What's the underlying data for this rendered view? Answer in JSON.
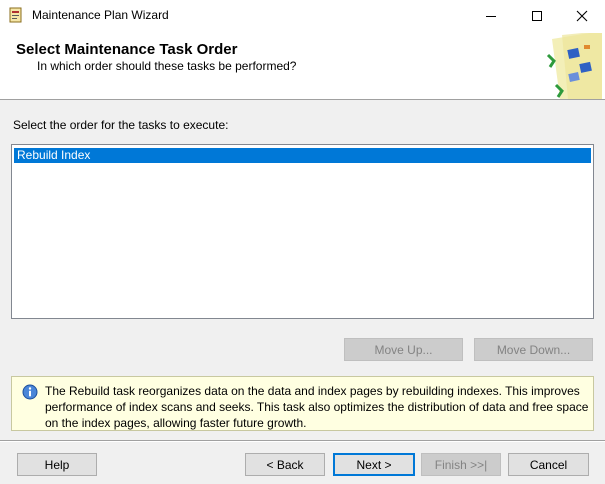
{
  "window": {
    "title": "Maintenance Plan Wizard",
    "icons": {
      "app": "wizard-app-icon",
      "minimize": "minimize-icon",
      "maximize": "maximize-icon",
      "close": "close-icon"
    }
  },
  "header": {
    "title": "Select Maintenance Task Order",
    "subtitle": "In which order should these tasks be performed?",
    "art": "wizard-graphic-icon"
  },
  "main": {
    "instruction": "Select the order for the tasks to execute:",
    "tasks": [
      {
        "label": "Rebuild Index",
        "selected": true
      }
    ],
    "move_up_label": "Move Up...",
    "move_down_label": "Move Down...",
    "info_text": "The Rebuild task reorganizes data on the data and index pages by rebuilding indexes. This improves performance of index scans and seeks. This task also optimizes the distribution of data and free space on the index pages, allowing faster future growth.",
    "info_icon": "info-icon"
  },
  "footer": {
    "help_label": "Help",
    "back_label": "< Back",
    "next_label": "Next >",
    "finish_label": "Finish >>|",
    "cancel_label": "Cancel"
  },
  "colors": {
    "selection": "#0078d7",
    "info_background": "#ffffe1",
    "dialog_background": "#f0f0f0"
  }
}
